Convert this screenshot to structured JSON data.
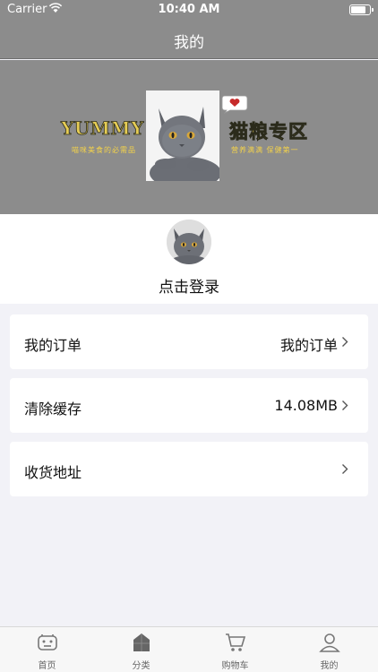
{
  "status_bar": {
    "carrier": "Carrier",
    "time": "10:40 AM"
  },
  "nav": {
    "title": "我的"
  },
  "banner": {
    "brand": "YUMMY",
    "slogan_left": "喵咪美食的必需品",
    "zone_title": "猫粮专区",
    "slogan_right": "营养满满 保健第一"
  },
  "profile": {
    "login_text": "点击登录"
  },
  "menu": {
    "orders": {
      "label": "我的订单",
      "value": "我的订单"
    },
    "cache": {
      "label": "清除缓存",
      "value": "14.08MB"
    },
    "address": {
      "label": "收货地址",
      "value": ""
    }
  },
  "tabs": [
    {
      "label": "首页",
      "icon": "home-icon"
    },
    {
      "label": "分类",
      "icon": "category-icon"
    },
    {
      "label": "购物车",
      "icon": "cart-icon"
    },
    {
      "label": "我的",
      "icon": "profile-icon"
    }
  ],
  "colors": {
    "header": "#8c8c8c",
    "background": "#f2f2f7",
    "card": "#ffffff",
    "banner_text": "#e6cd55"
  }
}
